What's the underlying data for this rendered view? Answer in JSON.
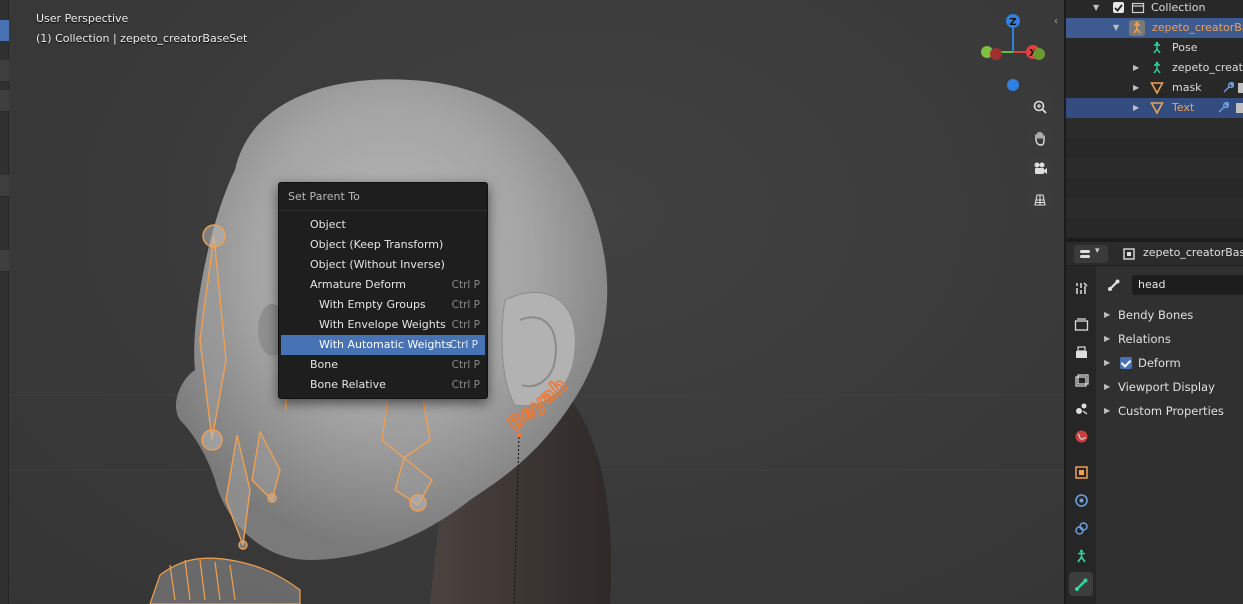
{
  "viewport": {
    "perspective_label": "User Perspective",
    "collection_label": "(1) Collection | zepeto_creatorBaseSet",
    "gizmo_axes": {
      "z": "Z",
      "x": "X"
    },
    "text_object_label": "Beyah"
  },
  "context_menu": {
    "title": "Set Parent To",
    "items": [
      {
        "label": "Object",
        "shortcut": ""
      },
      {
        "label": "Object (Keep Transform)",
        "shortcut": ""
      },
      {
        "label": "Object (Without Inverse)",
        "shortcut": ""
      },
      {
        "label": "Armature Deform",
        "shortcut": "Ctrl P"
      },
      {
        "label": "With Empty Groups",
        "shortcut": "Ctrl P"
      },
      {
        "label": "With Envelope Weights",
        "shortcut": "Ctrl P"
      },
      {
        "label": "With Automatic Weights",
        "shortcut": "Ctrl P"
      },
      {
        "label": "Bone",
        "shortcut": "Ctrl P"
      },
      {
        "label": "Bone Relative",
        "shortcut": "Ctrl P"
      }
    ]
  },
  "outliner": {
    "rows": [
      {
        "label": "Collection"
      },
      {
        "label": "zepeto_creatorBaseSet"
      },
      {
        "label": "Pose"
      },
      {
        "label": "zepeto_creatorBaseSet"
      },
      {
        "label": "mask"
      },
      {
        "label": "Text"
      }
    ]
  },
  "properties": {
    "header_object": "zepeto_creatorBaseSet",
    "bone_name": "head",
    "panels": [
      {
        "label": "Bendy Bones"
      },
      {
        "label": "Relations"
      },
      {
        "label": "Deform",
        "checked": true
      },
      {
        "label": "Viewport Display"
      },
      {
        "label": "Custom Properties"
      }
    ]
  },
  "colors": {
    "selection_blue": "#4772b3",
    "armature_orange": "#f0a050",
    "bone_teal": "#2fd7a0"
  }
}
